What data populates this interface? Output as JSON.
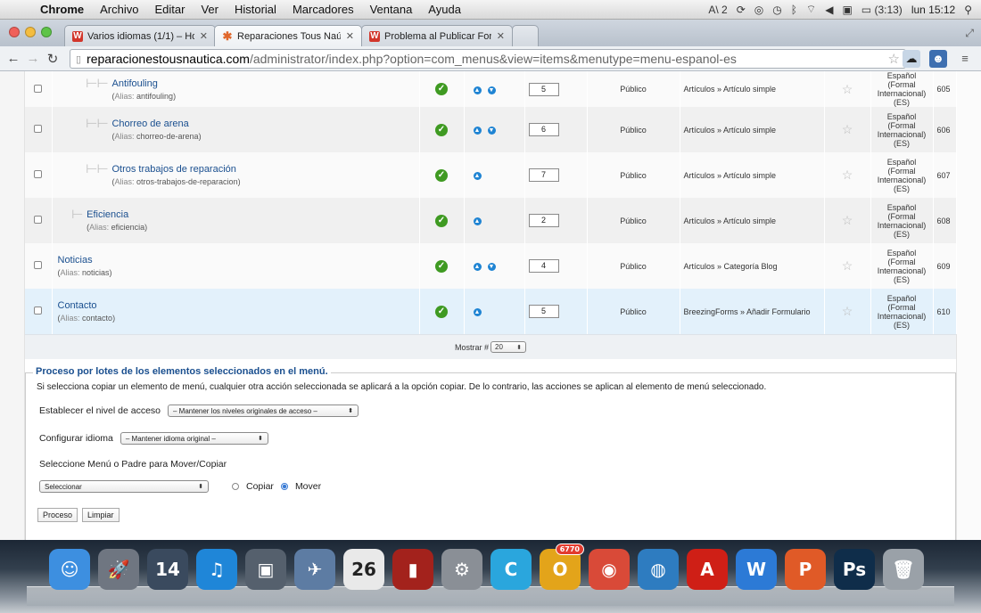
{
  "menubar": {
    "app": "Chrome",
    "items": [
      "Archivo",
      "Editar",
      "Ver",
      "Historial",
      "Marcadores",
      "Ventana",
      "Ayuda"
    ],
    "status": {
      "ai_badge": "2",
      "battery": "(3:13)",
      "clock": "lun 15:12"
    }
  },
  "tabs": [
    {
      "title": "Varios idiomas (1/1) – Ho",
      "favicon": "W",
      "active": false
    },
    {
      "title": "Reparaciones Tous Naútica",
      "favicon": "✱",
      "active": true
    },
    {
      "title": "Problema al Publicar Form",
      "favicon": "W",
      "active": false
    }
  ],
  "omnibox": {
    "host": "reparacionestousnautica.com",
    "path": "/administrator/index.php?option=com_menus&view=items&menutype=menu-espanol-es"
  },
  "alias_label": "Alias:",
  "rows": [
    {
      "title": "Antifouling",
      "alias": "antifouling",
      "depth": 2,
      "arrows": [
        "up",
        "down"
      ],
      "order": "5",
      "access": "Público",
      "link": "Artículos » Artículo simple",
      "lang": [
        "Español",
        "(Formal",
        "Internacional)",
        "(ES)"
      ],
      "id": "605",
      "style": "first"
    },
    {
      "title": "Chorreo de arena",
      "alias": "chorreo-de-arena",
      "depth": 2,
      "arrows": [
        "up",
        "down"
      ],
      "order": "6",
      "access": "Público",
      "link": "Artículos » Artículo simple",
      "lang": [
        "Español",
        "(Formal",
        "Internacional)",
        "(ES)"
      ],
      "id": "606",
      "style": "odd"
    },
    {
      "title": "Otros trabajos de reparación",
      "alias": "otros-trabajos-de-reparacion",
      "depth": 2,
      "arrows": [
        "up"
      ],
      "order": "7",
      "access": "Público",
      "link": "Artículos » Artículo simple",
      "lang": [
        "Español",
        "(Formal",
        "Internacional)",
        "(ES)"
      ],
      "id": "607",
      "style": "even"
    },
    {
      "title": "Eficiencia",
      "alias": "eficiencia",
      "depth": 1,
      "arrows": [
        "up"
      ],
      "order": "2",
      "access": "Público",
      "link": "Artículos » Artículo simple",
      "lang": [
        "Español",
        "(Formal",
        "Internacional)",
        "(ES)"
      ],
      "id": "608",
      "style": "odd"
    },
    {
      "title": "Noticias",
      "alias": "noticias",
      "depth": 0,
      "arrows": [
        "up",
        "down"
      ],
      "order": "4",
      "access": "Público",
      "link": "Artículos » Categoría Blog",
      "lang": [
        "Español",
        "(Formal",
        "Internacional)",
        "(ES)"
      ],
      "id": "609",
      "style": "even"
    },
    {
      "title": "Contacto",
      "alias": "contacto",
      "depth": 0,
      "arrows": [
        "up"
      ],
      "order": "5",
      "access": "Público",
      "link": "BreezingForms » Añadir Formulario",
      "lang": [
        "Español",
        "(Formal",
        "Internacional)",
        "(ES)"
      ],
      "id": "610",
      "style": "hl"
    }
  ],
  "pagination": {
    "label": "Mostrar #",
    "value": "20"
  },
  "batch": {
    "legend": "Proceso por lotes de los elementos seleccionados en el menú.",
    "description": "Si selecciona copiar un elemento de menú, cualquier otra acción seleccionada se aplicará a la opción copiar. De lo contrario, las acciones se aplican al elemento de menú seleccionado.",
    "access_label": "Establecer el nivel de acceso",
    "access_value": "– Mantener los niveles originales de acceso –",
    "lang_label": "Configurar idioma",
    "lang_value": "– Mantener idioma original –",
    "move_label": "Seleccione Menú o Padre para Mover/Copiar",
    "move_value": "Seleccionar",
    "copy_label": "Copiar",
    "move_radio_label": "Mover",
    "selected_mode": "Mover",
    "process_button": "Proceso",
    "clear_button": "Limpiar"
  },
  "dock": {
    "items": [
      {
        "name": "finder",
        "glyph": "☺",
        "color": "#3d8fe0"
      },
      {
        "name": "launchpad",
        "glyph": "🚀",
        "color": "#6f7681"
      },
      {
        "name": "dashboard",
        "glyph": "14",
        "color": "#3a4a5e"
      },
      {
        "name": "itunes",
        "glyph": "♫",
        "color": "#1f86d8"
      },
      {
        "name": "iphoto",
        "glyph": "▣",
        "color": "#55606d"
      },
      {
        "name": "preview",
        "glyph": "✈",
        "color": "#5d7ca3"
      },
      {
        "name": "calendar",
        "glyph": "26",
        "color": "#e9e9e9"
      },
      {
        "name": "photo-booth",
        "glyph": "▮",
        "color": "#a3221c"
      },
      {
        "name": "system-preferences",
        "glyph": "⚙",
        "color": "#8a8f96"
      },
      {
        "name": "app-c",
        "glyph": "C",
        "color": "#2aa6dd"
      },
      {
        "name": "app-o",
        "glyph": "O",
        "color": "#e3a41a",
        "badge": "6770"
      },
      {
        "name": "chrome",
        "glyph": "◉",
        "color": "#d94a38"
      },
      {
        "name": "app-globe",
        "glyph": "◍",
        "color": "#2e7cc0"
      },
      {
        "name": "acrobat",
        "glyph": "A",
        "color": "#cf1f16"
      },
      {
        "name": "word",
        "glyph": "W",
        "color": "#2c7ad6"
      },
      {
        "name": "powerpoint",
        "glyph": "P",
        "color": "#e05a27"
      },
      {
        "name": "photoshop",
        "glyph": "Ps",
        "color": "#0f2d4a"
      },
      {
        "name": "trash",
        "glyph": "🗑",
        "color": "#9aa1a8"
      }
    ]
  }
}
